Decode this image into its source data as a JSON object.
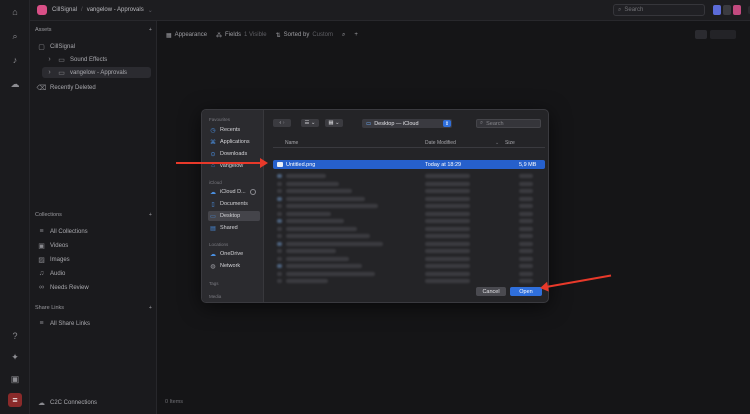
{
  "topbar": {
    "workspace": "CillSignal",
    "board": "vangelow - Approvals",
    "search_placeholder": "Search"
  },
  "sidebar": {
    "assets_header": "Assets",
    "items": [
      {
        "label": "CillSignal",
        "icon": "project-icon"
      },
      {
        "label": "Sound Effects",
        "icon": "folder-icon"
      },
      {
        "label": "vangelow - Approvals",
        "icon": "folder-icon"
      },
      {
        "label": "Recently Deleted",
        "icon": "trash-icon"
      }
    ],
    "collections_header": "Collections",
    "collections": [
      {
        "label": "All Collections"
      },
      {
        "label": "Videos"
      },
      {
        "label": "Images"
      },
      {
        "label": "Audio"
      },
      {
        "label": "Needs Review"
      }
    ],
    "share_header": "Share Links",
    "share_items": [
      {
        "label": "All Share Links"
      }
    ],
    "footer": "C2C Connections"
  },
  "toolbar": {
    "appearance": "Appearance",
    "fields": "Fields",
    "fields_count": "1 Visible",
    "sorted": "Sorted by",
    "sorted_value": "Custom"
  },
  "main": {
    "items_count": "0 Items"
  },
  "dialog": {
    "favourites_header": "Favourites",
    "favourites": [
      {
        "label": "Recents",
        "icon": "clock-icon"
      },
      {
        "label": "Applications",
        "icon": "applications-icon"
      },
      {
        "label": "Downloads",
        "icon": "download-icon"
      },
      {
        "label": "vangelow",
        "icon": "home-icon"
      }
    ],
    "icloud_header": "iCloud",
    "icloud": [
      {
        "label": "iCloud D...",
        "icon": "cloud-icon"
      },
      {
        "label": "Documents",
        "icon": "document-icon"
      },
      {
        "label": "Desktop",
        "icon": "desktop-icon"
      },
      {
        "label": "Shared",
        "icon": "shared-folder-icon"
      }
    ],
    "locations_header": "Locations",
    "locations": [
      {
        "label": "OneDrive",
        "icon": "cloud-icon"
      },
      {
        "label": "Network",
        "icon": "globe-icon"
      }
    ],
    "tags_header": "Tags",
    "media_header": "Media",
    "location": "Desktop — iCloud",
    "search_placeholder": "Search",
    "columns": {
      "name": "Name",
      "date": "Date Modified",
      "size": "Size"
    },
    "selected_file": {
      "name": "Untitled.png",
      "date": "Today at 18:29",
      "size": "5,9 MB"
    },
    "cancel_label": "Cancel",
    "open_label": "Open"
  },
  "colors": {
    "accent_blue": "#2f6fdc",
    "selection_blue": "#2660cc",
    "annotation_red": "#e8392a",
    "brand_pink": "#d94f86"
  }
}
